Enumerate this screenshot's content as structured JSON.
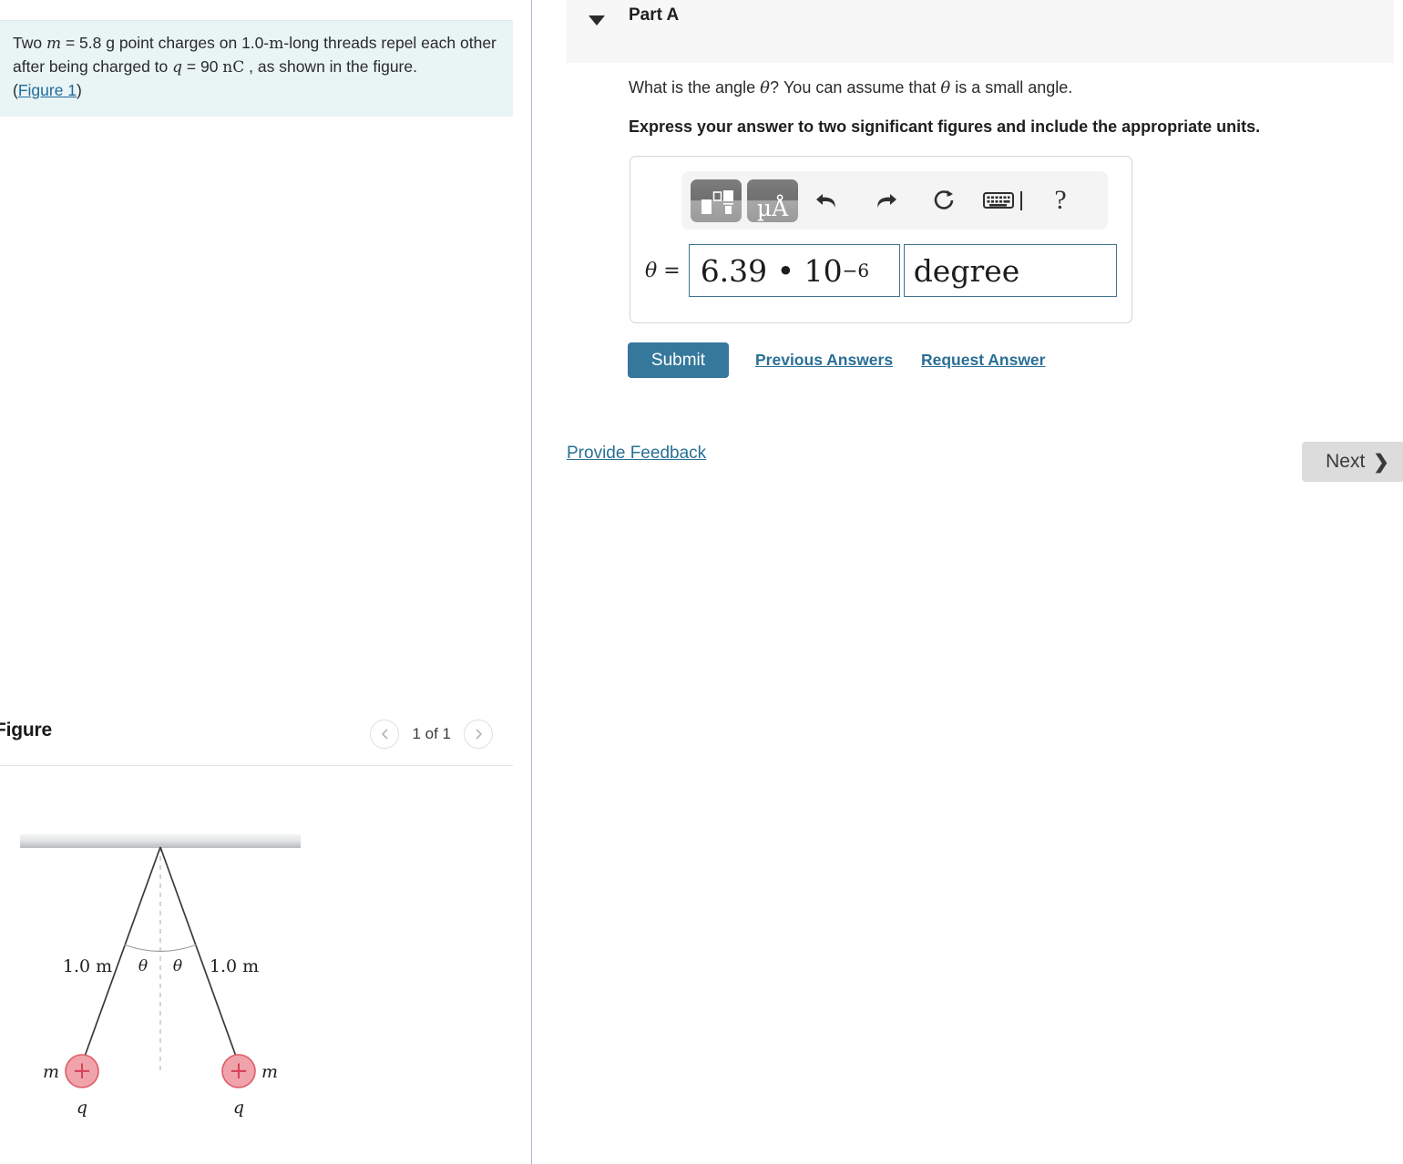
{
  "problem": {
    "line1_pre": "Two ",
    "var_m": "m",
    "line1_mid": " = 5.8 g point charges on 1.0-",
    "unit_m": "m",
    "line1_post": "-long threads",
    "line2_pre": "repel each other after being charged to ",
    "var_q": "q",
    "line2_mid": " = 90 ",
    "unit_nC": "nC",
    "line2_post": " , as",
    "line3": "shown in the figure.",
    "figure_link_open": "(",
    "figure_link": "Figure 1",
    "figure_link_close": ")"
  },
  "figure_panel": {
    "title": "Figure",
    "page_count": "1 of 1",
    "prev_icon": "chevron-left-icon",
    "next_icon": "chevron-right-icon"
  },
  "figure_diagram": {
    "left_thread_label": "1.0 m",
    "right_thread_label": "1.0 m",
    "angle_left": "θ",
    "angle_right": "θ",
    "mass_left": "m",
    "mass_right": "m",
    "charge_left": "q",
    "charge_right": "q",
    "charge_sign": "+",
    "charge_fill": "#f0a3ab",
    "charge_stroke": "#de5b68",
    "ceiling_top_color": "#f2f3f4",
    "ceiling_bottom_color": "#b9bdc0",
    "thread_color": "#3a3a3a"
  },
  "part": {
    "caret_icon": "caret-down-icon",
    "label": "Part A",
    "question_pre": "What is the angle ",
    "question_theta1": "θ",
    "question_mid": "? You can assume that ",
    "question_theta2": "θ",
    "question_post": " is a small angle.",
    "instruction": "Express your answer to two significant figures and include the appropriate units."
  },
  "answer": {
    "toolbar": {
      "template_icon": "math-template-icon",
      "units_icon": "units-micro-angstrom-icon",
      "units_glyph": "µÅ",
      "undo_icon": "undo-icon",
      "redo_icon": "redo-icon",
      "reset_icon": "reset-icon",
      "keyboard_icon": "keyboard-icon",
      "help_label": "?"
    },
    "prefix_var": "θ",
    "prefix_eq": " =",
    "value_mantissa": "6.39 • 10",
    "value_exponent": "−6",
    "unit_value": "degree",
    "value_placeholder": "",
    "unit_placeholder": ""
  },
  "actions": {
    "submit_label": "Submit",
    "previous_answers_label": "Previous Answers",
    "request_answer_label": "Request Answer",
    "feedback_label": "Provide Feedback",
    "next_label": "Next",
    "next_chevron": "❯"
  },
  "colors": {
    "info_box_bg": "#e9f4f5",
    "link": "#2a6f96",
    "submit_bg": "#36789c",
    "next_bg": "#dcdcdc",
    "part_header_bg": "#f7f7f7",
    "field_border": "#3f7391"
  }
}
